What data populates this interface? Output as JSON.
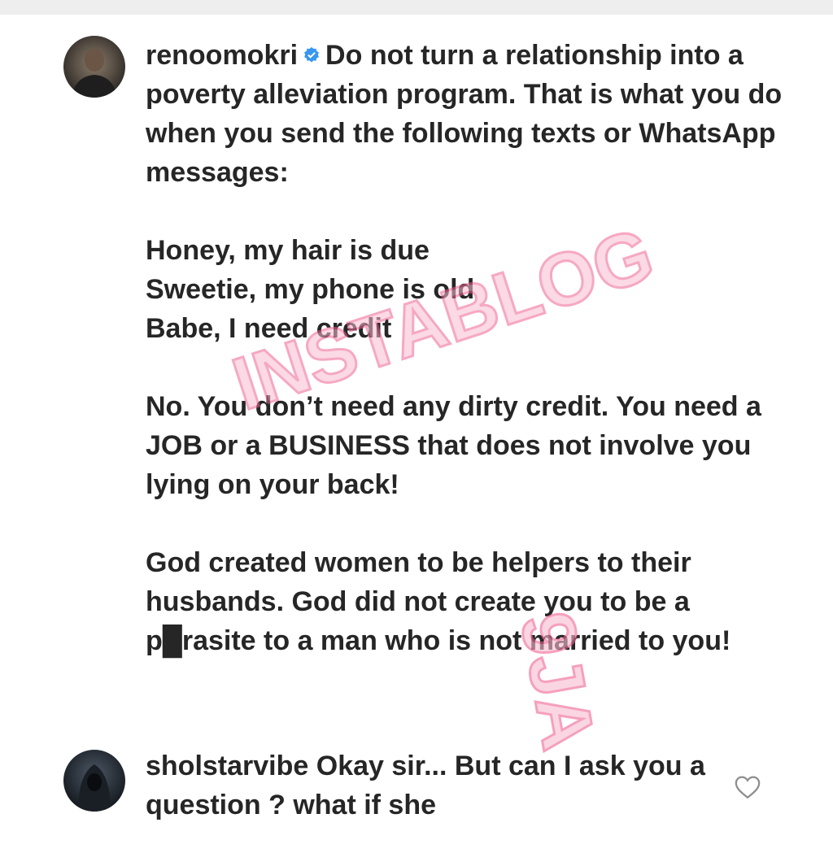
{
  "comments": [
    {
      "username": "renoomokri",
      "verified": true,
      "paragraphs": [
        "Do not turn a relationship into a poverty alleviation program. That is what you do when you send the following texts or WhatsApp messages:",
        "Honey, my hair is due",
        "Sweetie, my phone is old",
        "Babe, I need credit",
        "No. You don’t need any dirty credit. You need a JOB or a BUSINESS that does not involve you lying on your back!",
        "God created women to be helpers to their husbands. God did not create you to be a p█rasite to a man who is not married to you!"
      ]
    },
    {
      "username": "sholstarvibe",
      "text": "Okay sir... But can I ask you a question ? what if she"
    }
  ],
  "watermark": {
    "text_main": "INSTABLOG",
    "text_tail": "9JA",
    "color": "#f06292"
  },
  "colors": {
    "verified_badge": "#3897f0",
    "text": "#262626"
  },
  "icons": {
    "verified": "verified-badge-icon",
    "like": "heart-icon"
  }
}
